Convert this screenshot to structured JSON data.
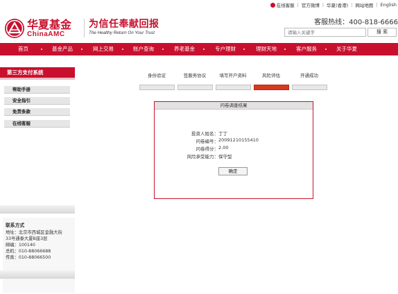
{
  "top_links": [
    "在线客服",
    "官方微博",
    "华夏(香港)",
    "网站地图",
    "English"
  ],
  "brand": {
    "name_cn": "华夏基金",
    "name_en": "ChinaAMC",
    "slogan_cn": "为信任奉献回报",
    "slogan_en": "The Healthy Return On Your Trust",
    "color": "#c8102e"
  },
  "hotline": "客服热线：400-818-6666",
  "search": {
    "placeholder": "请输入关键字",
    "button": "搜 索"
  },
  "nav": [
    "首页",
    "基金产品",
    "网上交易",
    "账户查询",
    "养老基金",
    "专户理财",
    "理财天地",
    "客户服务",
    "关于华夏"
  ],
  "sidebar": {
    "title": "第三方支付系统",
    "items": [
      "帮助手册",
      "安全指引",
      "免责条款",
      "在线客服"
    ],
    "contact": {
      "title": "联系方式",
      "lines": [
        "地址：北京市西城区金融大街",
        "33号通泰大厦B座3层",
        "邮编：100140",
        "总机：010-88066688",
        "传真：010-88066500"
      ]
    }
  },
  "steps": {
    "labels": [
      "身份验证",
      "签服务协议",
      "填写开户资料",
      "风险评估",
      "开通成功"
    ],
    "active_index": 3
  },
  "result": {
    "title": "问卷调查结果",
    "fields": [
      {
        "label": "投资人姓名：",
        "value": "丁丁"
      },
      {
        "label": "问卷编号：",
        "value": "20091210155410"
      },
      {
        "label": "问卷得分：",
        "value": "2.00"
      },
      {
        "label": "风险承受能力：",
        "value": "保守型"
      }
    ],
    "confirm": "确定"
  }
}
